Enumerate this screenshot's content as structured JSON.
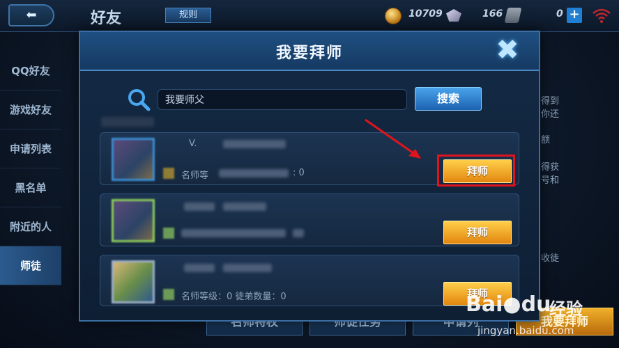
{
  "topbar": {
    "back_icon": "back-arrow-icon",
    "title": "好友",
    "rules_label": "规则",
    "gold": "10709",
    "gems": "166",
    "tickets": "0",
    "plus": "+"
  },
  "sidebar": {
    "items": [
      {
        "label": "QQ好友"
      },
      {
        "label": "游戏好友"
      },
      {
        "label": "申请列表"
      },
      {
        "label": "黑名单"
      },
      {
        "label": "附近的人"
      },
      {
        "label": "师徒"
      }
    ]
  },
  "right_peek": [
    "得到",
    "你还",
    "额",
    "得获",
    "号和",
    "收徒"
  ],
  "bottom_tabs": [
    "名师特权",
    "师徒任务",
    "申请列",
    "我要拜师"
  ],
  "modal": {
    "title": "我要拜师",
    "close_icon": "close-x-icon",
    "search": {
      "value": "我要师父",
      "button": "搜索"
    },
    "rows": [
      {
        "level_text": "V.",
        "stat_label": "名师等",
        "count": ": 0",
        "button": "拜师"
      },
      {
        "level_text": "",
        "stat_label": "",
        "count": "",
        "button": "拜师"
      },
      {
        "level_text": "",
        "stat_label": "名师等级：0 徒弟数量：0",
        "count": "",
        "button": "拜师"
      }
    ]
  },
  "watermark": {
    "logo": "Bai",
    "logo2": "du",
    "text": "经验",
    "url": "jingyan.baidu.com"
  },
  "colors": {
    "accent_blue": "#3b6ea3",
    "gold_button": "#e2860f",
    "highlight_red": "#e0141e"
  }
}
